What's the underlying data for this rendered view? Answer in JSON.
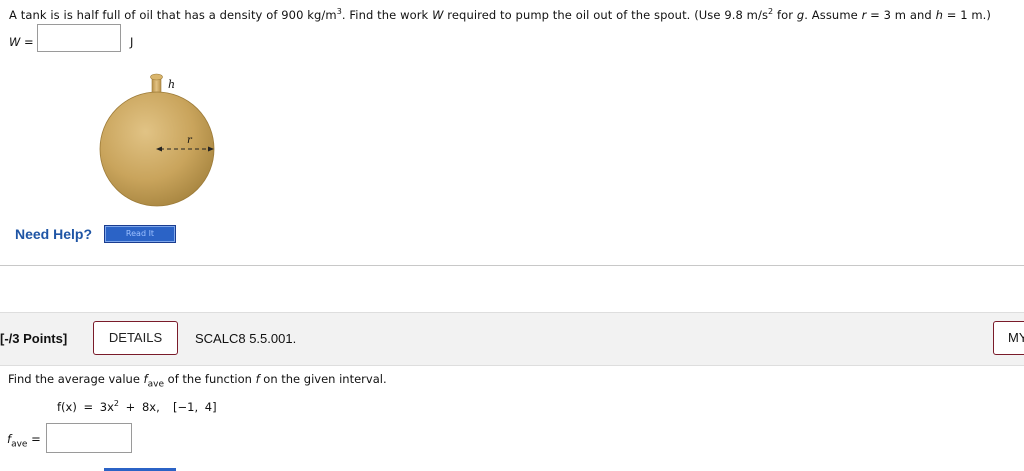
{
  "question1": {
    "text_a": "A tank is is half full of oil that has a density of 900 kg/m",
    "sup_a": "3",
    "text_b": ". Find the work ",
    "var_w": "W",
    "text_c": " required to pump the oil out of the spout. (Use 9.8 m/s",
    "sup_b": "2",
    "text_d": " for ",
    "var_g": "g",
    "text_e": ". Assume ",
    "var_r": "r",
    "text_f": " = 3 m and ",
    "var_h": "h",
    "text_g": " = 1 m.)",
    "answer_label": "W =",
    "answer_value": "",
    "unit": "J"
  },
  "figure": {
    "h_label": "h",
    "r_label": "r",
    "colors": {
      "tank": "#c9a45c",
      "spout": "#d4ac5e",
      "outline": "#9c7a37"
    }
  },
  "help": {
    "label": "Need Help?",
    "read_button": "Read It",
    "colors": {
      "link": "#1f55a5",
      "button": "#2b63c6"
    }
  },
  "question2_header": {
    "points": "[-/3 Points]",
    "details_button": "DETAILS",
    "code": "SCALC8 5.5.001.",
    "my_button": "MY"
  },
  "question2": {
    "text_a": "Find the average value ",
    "fave_f": "f",
    "fave_sub": "ave",
    "text_b": " of the function ",
    "var_f": "f",
    "text_c": " on the given interval.",
    "func_lhs": "f(x) = 3x",
    "func_sup": "2",
    "func_rhs": " + 8x,",
    "interval": "[−1, 4]",
    "answer_label_f": "f",
    "answer_label_sub": "ave",
    "answer_label_eq": " =",
    "answer_value": ""
  }
}
